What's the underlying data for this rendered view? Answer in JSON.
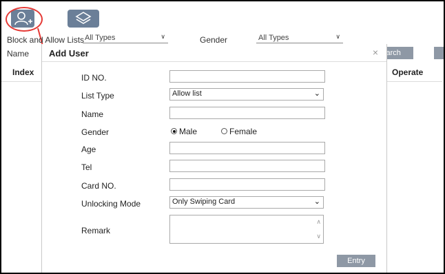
{
  "background": {
    "filter_label": "Block and Allow Lists",
    "filter_value": "All Types",
    "gender_label": "Gender",
    "gender_value": "All Types",
    "name_label": "Name",
    "search_button": "Search",
    "columns": {
      "index": "Index",
      "operate": "Operate"
    }
  },
  "dialog": {
    "title": "Add User",
    "close_glyph": "×",
    "fields": {
      "id_no": {
        "label": "ID NO.",
        "value": ""
      },
      "list_type": {
        "label": "List Type",
        "value": "Allow list"
      },
      "name": {
        "label": "Name",
        "value": ""
      },
      "gender": {
        "label": "Gender",
        "options": [
          "Male",
          "Female"
        ],
        "selected": "Male"
      },
      "age": {
        "label": "Age",
        "value": ""
      },
      "tel": {
        "label": "Tel",
        "value": ""
      },
      "card_no": {
        "label": "Card NO.",
        "value": ""
      },
      "unlocking_mode": {
        "label": "Unlocking Mode",
        "value": "Only Swiping Card"
      },
      "remark": {
        "label": "Remark",
        "value": ""
      }
    },
    "entry_button": "Entry"
  },
  "colors": {
    "toolbar_button": "#6b7f98",
    "highlight_oval": "#e53935",
    "action_button": "#8e98a5"
  },
  "icons": [
    "add-user-icon",
    "layers-icon",
    "close-icon",
    "chevron-down-icon",
    "spinner-up-icon",
    "spinner-down-icon"
  ]
}
